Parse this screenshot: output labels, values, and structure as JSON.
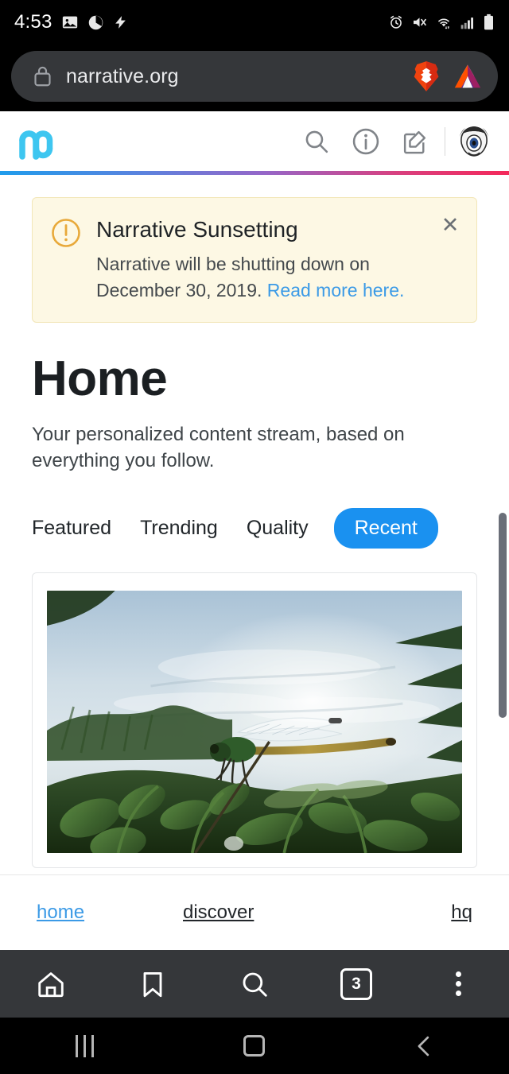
{
  "status_bar": {
    "time": "4:53",
    "left_icons": [
      "image-icon",
      "brave-rewards-icon",
      "flash-icon"
    ],
    "right_icons": [
      "alarm-icon",
      "volume-mute-icon",
      "wifi-icon",
      "signal-icon",
      "battery-icon"
    ]
  },
  "browser": {
    "url": "narrative.org",
    "lock_icon": "lock-icon",
    "shield_icon": "brave-lion-icon",
    "rewards_icon": "bat-triangle-icon",
    "bottom_bar": {
      "home_label": "home-icon",
      "bookmarks_label": "bookmark-icon",
      "search_label": "search-icon",
      "tab_count": "3",
      "menu_label": "more-vertical-icon"
    }
  },
  "site_header": {
    "logo_name": "narrative-logo",
    "icons": [
      {
        "name": "search-icon"
      },
      {
        "name": "info-icon"
      },
      {
        "name": "compose-icon"
      }
    ],
    "avatar_name": "user-avatar"
  },
  "alert": {
    "icon": "warning-icon",
    "title": "Narrative Sunsetting",
    "body_text": "Narrative will be shutting down on December 30, 2019. ",
    "link_text": "Read more here.",
    "close_label": "✕"
  },
  "main": {
    "title": "Home",
    "subtitle": "Your personalized content stream, based on everything you follow.",
    "tabs": [
      {
        "label": "Featured",
        "active": false
      },
      {
        "label": "Trending",
        "active": false
      },
      {
        "label": "Quality",
        "active": false
      },
      {
        "label": "Recent",
        "active": true
      }
    ],
    "card": {
      "image_alt": "damselfly-on-plant-photo"
    }
  },
  "site_footer": {
    "links": [
      {
        "label": "home",
        "active": true
      },
      {
        "label": "discover",
        "active": false
      },
      {
        "label": "hq",
        "active": false
      }
    ]
  },
  "android_nav": {
    "recents_label": "recents-icon",
    "home_label": "home-icon",
    "back_label": "‹"
  },
  "colors": {
    "accent_blue": "#1a91f0",
    "link_blue": "#3b9ae6",
    "logo_cyan": "#3ec6f0",
    "alert_bg": "#fdf8e4",
    "alert_border": "#f2e6b8",
    "warning_amber": "#e8a93a",
    "browser_chrome": "#35373a",
    "gradient_start": "#1f9cec",
    "gradient_end": "#f4285a"
  }
}
